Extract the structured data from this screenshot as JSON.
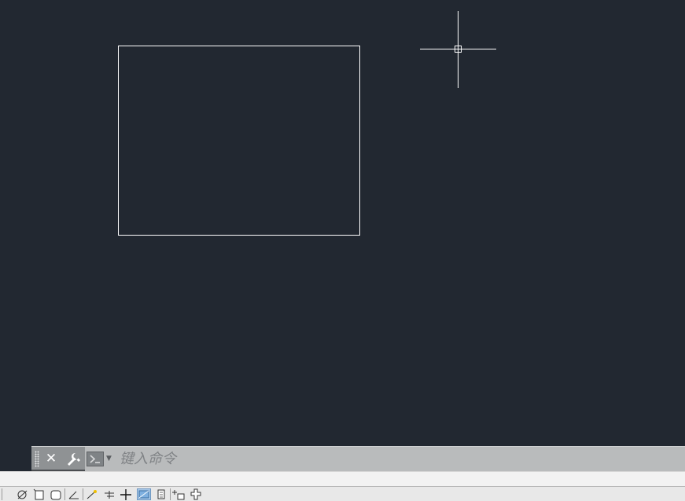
{
  "canvas": {
    "background": "#222831",
    "entity": "rectangle",
    "cursor": "crosshair-pickbox"
  },
  "command_line": {
    "placeholder": "键入命令",
    "close_icon": "close-icon",
    "customize_icon": "wrench-icon",
    "recent_commands_icon": "command-prompt-icon"
  },
  "status_bar": {
    "buttons": [
      {
        "name": "model-space-tab-icon",
        "active": false
      },
      {
        "name": "polar-tracking-icon",
        "active": false
      },
      {
        "name": "isodraft-icon",
        "active": false
      },
      {
        "name": "object-snap-icon",
        "active": false
      },
      {
        "name": "dynamic-ucs-icon",
        "active": false
      },
      {
        "name": "dynamic-input-icon",
        "active": false
      },
      {
        "name": "lineweight-icon",
        "active": false
      },
      {
        "name": "crosshair-toggle-icon",
        "active": false
      },
      {
        "name": "transparency-icon",
        "active": true
      },
      {
        "name": "quick-properties-icon",
        "active": false
      },
      {
        "name": "selection-cycling-icon",
        "active": false
      },
      {
        "name": "annotation-monitor-icon",
        "active": false
      }
    ]
  }
}
